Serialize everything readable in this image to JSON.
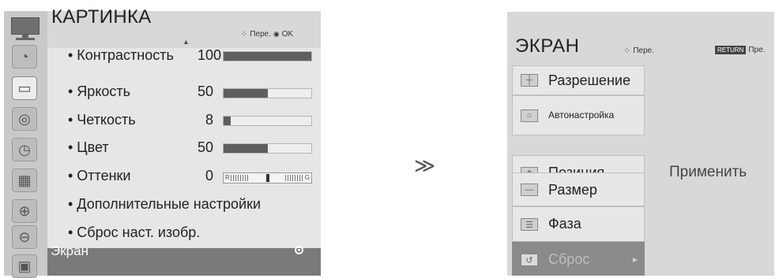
{
  "left_menu": {
    "title": "КАРТИНКА",
    "hint_move": "Пере.",
    "hint_ok": "OK",
    "items": [
      {
        "label": "• Контрастность",
        "value": "100",
        "level": 1.0
      },
      {
        "label": "• Яркость",
        "value": "50",
        "level": 0.5
      },
      {
        "label": "• Четкость",
        "value": "8",
        "level": 0.08
      },
      {
        "label": "• Цвет",
        "value": "50",
        "level": 0.5
      },
      {
        "label": "• Оттенки",
        "value": "0"
      },
      {
        "label": "• Дополнительные настройки"
      },
      {
        "label": "• Сброс наст. изобр."
      }
    ],
    "tint_left": "R",
    "tint_right": "G",
    "footer_label": "Экран"
  },
  "center_arrow": "≫",
  "right_menu": {
    "title": "ЭКРАН",
    "hint_move": "Пере.",
    "return_label": "RETURN",
    "hint_prev": "Пре.",
    "items": [
      {
        "label": "Разрешение"
      },
      {
        "label": "Автонастройка"
      },
      {
        "label": "Позиция"
      },
      {
        "label": "Размер"
      },
      {
        "label": "Фаза"
      },
      {
        "label": "Сброс"
      }
    ],
    "apply_label": "Применить"
  }
}
